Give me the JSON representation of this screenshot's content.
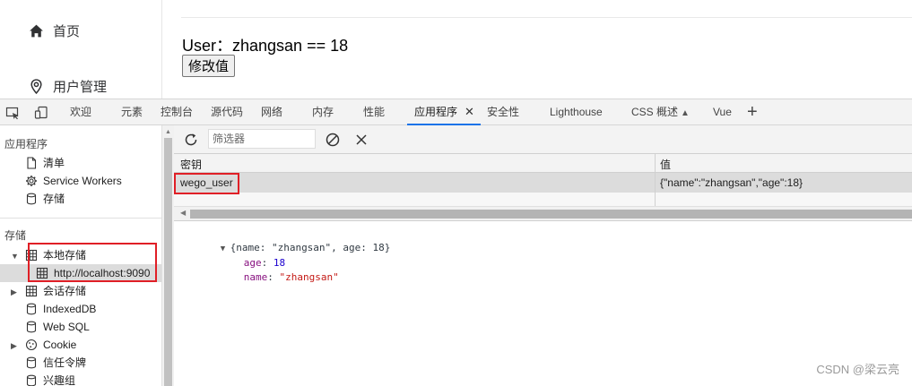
{
  "app": {
    "nav": [
      {
        "label": "首页",
        "icon": "home-icon"
      },
      {
        "label": "用户管理",
        "icon": "location-icon"
      }
    ],
    "user_line": "User：zhangsan == 18",
    "modify_button": "修改值"
  },
  "devtools": {
    "tabs": [
      "欢迎",
      "元素",
      "控制台",
      "源代码",
      "网络",
      "内存",
      "性能",
      "应用程序",
      "安全性",
      "Lighthouse",
      "CSS 概述",
      "Vue"
    ],
    "active_tab": "应用程序",
    "left": {
      "app_section": "应用程序",
      "app_items": [
        {
          "label": "清单",
          "icon": "file-icon"
        },
        {
          "label": "Service Workers",
          "icon": "gear-icon"
        },
        {
          "label": "存储",
          "icon": "database-icon"
        }
      ],
      "storage_section": "存储",
      "local_storage": "本地存储",
      "local_storage_child": "http://localhost:9090",
      "session_storage": "会话存储",
      "indexeddb": "IndexedDB",
      "websql": "Web SQL",
      "cookie": "Cookie",
      "trust_tokens": "信任令牌",
      "interest_groups": "兴趣组"
    },
    "filter_placeholder": "筛选器",
    "table": {
      "col_key": "密钥",
      "col_value": "值",
      "rows": [
        {
          "key": "wego_user",
          "value": "{\"name\":\"zhangsan\",\"age\":18}"
        }
      ]
    },
    "preview": {
      "summary": "{name: \"zhangsan\", age: 18}",
      "props": [
        {
          "key": "age",
          "value": "18"
        },
        {
          "key": "name",
          "value": "\"zhangsan\""
        }
      ]
    },
    "colors": {
      "accent": "#1a73e8",
      "highlight": "#e01f26"
    }
  },
  "watermark": "CSDN @梁云亮"
}
